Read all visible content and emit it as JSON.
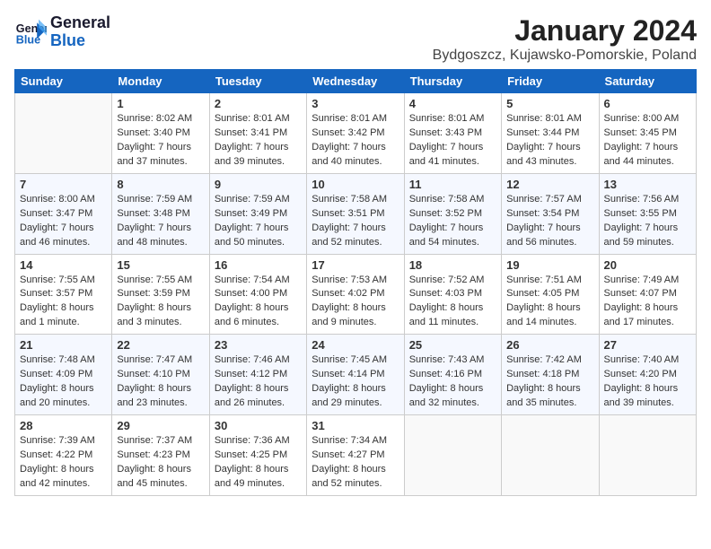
{
  "header": {
    "logo_line1": "General",
    "logo_line2": "Blue",
    "month_title": "January 2024",
    "location": "Bydgoszcz, Kujawsko-Pomorskie, Poland"
  },
  "weekdays": [
    "Sunday",
    "Monday",
    "Tuesday",
    "Wednesday",
    "Thursday",
    "Friday",
    "Saturday"
  ],
  "weeks": [
    [
      {
        "day": "",
        "info": ""
      },
      {
        "day": "1",
        "info": "Sunrise: 8:02 AM\nSunset: 3:40 PM\nDaylight: 7 hours\nand 37 minutes."
      },
      {
        "day": "2",
        "info": "Sunrise: 8:01 AM\nSunset: 3:41 PM\nDaylight: 7 hours\nand 39 minutes."
      },
      {
        "day": "3",
        "info": "Sunrise: 8:01 AM\nSunset: 3:42 PM\nDaylight: 7 hours\nand 40 minutes."
      },
      {
        "day": "4",
        "info": "Sunrise: 8:01 AM\nSunset: 3:43 PM\nDaylight: 7 hours\nand 41 minutes."
      },
      {
        "day": "5",
        "info": "Sunrise: 8:01 AM\nSunset: 3:44 PM\nDaylight: 7 hours\nand 43 minutes."
      },
      {
        "day": "6",
        "info": "Sunrise: 8:00 AM\nSunset: 3:45 PM\nDaylight: 7 hours\nand 44 minutes."
      }
    ],
    [
      {
        "day": "7",
        "info": "Sunrise: 8:00 AM\nSunset: 3:47 PM\nDaylight: 7 hours\nand 46 minutes."
      },
      {
        "day": "8",
        "info": "Sunrise: 7:59 AM\nSunset: 3:48 PM\nDaylight: 7 hours\nand 48 minutes."
      },
      {
        "day": "9",
        "info": "Sunrise: 7:59 AM\nSunset: 3:49 PM\nDaylight: 7 hours\nand 50 minutes."
      },
      {
        "day": "10",
        "info": "Sunrise: 7:58 AM\nSunset: 3:51 PM\nDaylight: 7 hours\nand 52 minutes."
      },
      {
        "day": "11",
        "info": "Sunrise: 7:58 AM\nSunset: 3:52 PM\nDaylight: 7 hours\nand 54 minutes."
      },
      {
        "day": "12",
        "info": "Sunrise: 7:57 AM\nSunset: 3:54 PM\nDaylight: 7 hours\nand 56 minutes."
      },
      {
        "day": "13",
        "info": "Sunrise: 7:56 AM\nSunset: 3:55 PM\nDaylight: 7 hours\nand 59 minutes."
      }
    ],
    [
      {
        "day": "14",
        "info": "Sunrise: 7:55 AM\nSunset: 3:57 PM\nDaylight: 8 hours\nand 1 minute."
      },
      {
        "day": "15",
        "info": "Sunrise: 7:55 AM\nSunset: 3:59 PM\nDaylight: 8 hours\nand 3 minutes."
      },
      {
        "day": "16",
        "info": "Sunrise: 7:54 AM\nSunset: 4:00 PM\nDaylight: 8 hours\nand 6 minutes."
      },
      {
        "day": "17",
        "info": "Sunrise: 7:53 AM\nSunset: 4:02 PM\nDaylight: 8 hours\nand 9 minutes."
      },
      {
        "day": "18",
        "info": "Sunrise: 7:52 AM\nSunset: 4:03 PM\nDaylight: 8 hours\nand 11 minutes."
      },
      {
        "day": "19",
        "info": "Sunrise: 7:51 AM\nSunset: 4:05 PM\nDaylight: 8 hours\nand 14 minutes."
      },
      {
        "day": "20",
        "info": "Sunrise: 7:49 AM\nSunset: 4:07 PM\nDaylight: 8 hours\nand 17 minutes."
      }
    ],
    [
      {
        "day": "21",
        "info": "Sunrise: 7:48 AM\nSunset: 4:09 PM\nDaylight: 8 hours\nand 20 minutes."
      },
      {
        "day": "22",
        "info": "Sunrise: 7:47 AM\nSunset: 4:10 PM\nDaylight: 8 hours\nand 23 minutes."
      },
      {
        "day": "23",
        "info": "Sunrise: 7:46 AM\nSunset: 4:12 PM\nDaylight: 8 hours\nand 26 minutes."
      },
      {
        "day": "24",
        "info": "Sunrise: 7:45 AM\nSunset: 4:14 PM\nDaylight: 8 hours\nand 29 minutes."
      },
      {
        "day": "25",
        "info": "Sunrise: 7:43 AM\nSunset: 4:16 PM\nDaylight: 8 hours\nand 32 minutes."
      },
      {
        "day": "26",
        "info": "Sunrise: 7:42 AM\nSunset: 4:18 PM\nDaylight: 8 hours\nand 35 minutes."
      },
      {
        "day": "27",
        "info": "Sunrise: 7:40 AM\nSunset: 4:20 PM\nDaylight: 8 hours\nand 39 minutes."
      }
    ],
    [
      {
        "day": "28",
        "info": "Sunrise: 7:39 AM\nSunset: 4:22 PM\nDaylight: 8 hours\nand 42 minutes."
      },
      {
        "day": "29",
        "info": "Sunrise: 7:37 AM\nSunset: 4:23 PM\nDaylight: 8 hours\nand 45 minutes."
      },
      {
        "day": "30",
        "info": "Sunrise: 7:36 AM\nSunset: 4:25 PM\nDaylight: 8 hours\nand 49 minutes."
      },
      {
        "day": "31",
        "info": "Sunrise: 7:34 AM\nSunset: 4:27 PM\nDaylight: 8 hours\nand 52 minutes."
      },
      {
        "day": "",
        "info": ""
      },
      {
        "day": "",
        "info": ""
      },
      {
        "day": "",
        "info": ""
      }
    ]
  ]
}
